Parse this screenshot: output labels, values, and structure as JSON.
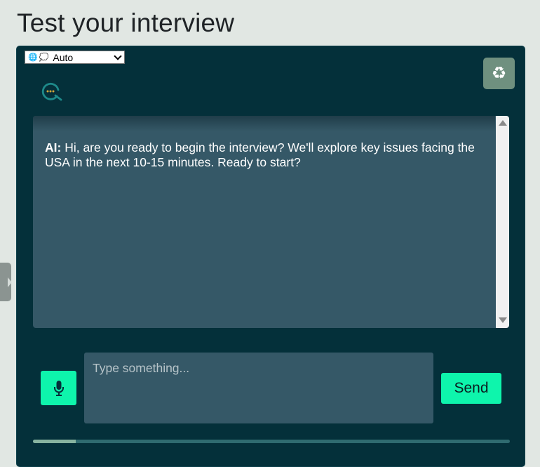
{
  "page": {
    "title": "Test your interview"
  },
  "language_select": {
    "globe_icon": "🌐",
    "bubble_icon": "💭",
    "value": "Auto"
  },
  "toolbar": {
    "reset_icon": "recycle-icon"
  },
  "chat": {
    "messages": [
      {
        "speaker": "AI:",
        "text": " Hi, are you ready to begin the interview? We'll explore key issues facing the USA in the next 10-15 minutes. Ready to start?"
      }
    ]
  },
  "composer": {
    "placeholder": "Type something...",
    "value": "",
    "send_label": "Send",
    "mic_icon": "microphone-icon"
  },
  "progress": {
    "fraction": 0.09
  },
  "colors": {
    "accent": "#0ef5ac",
    "panel": "#04303a",
    "chat_bg": "#355867",
    "reset_button": "#6f907f"
  }
}
